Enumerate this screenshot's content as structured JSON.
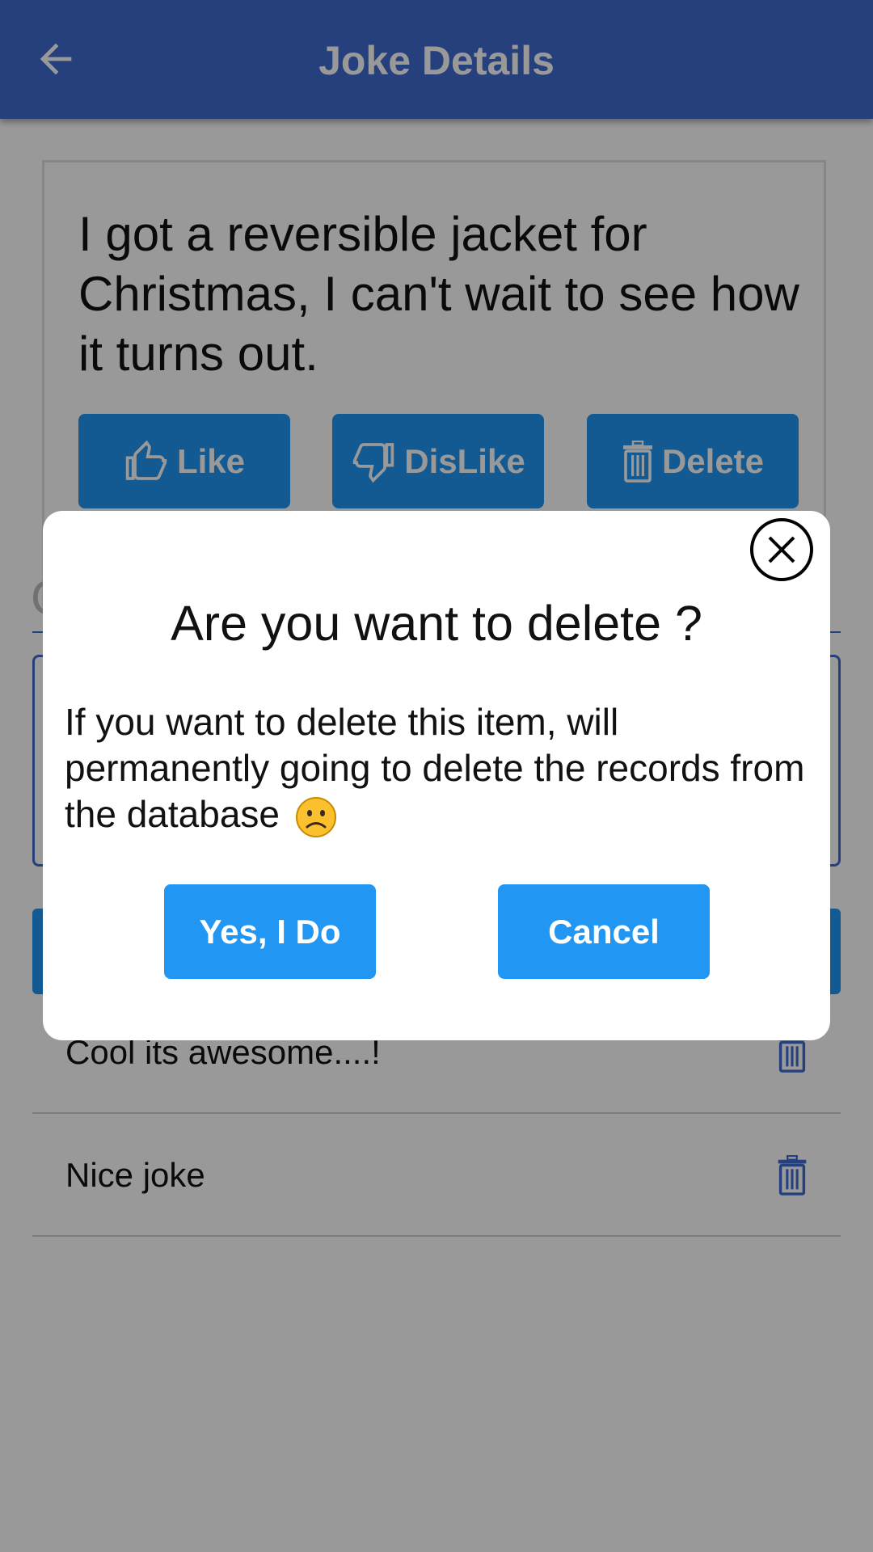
{
  "appbar": {
    "title": "Joke Details",
    "back_icon": "arrow-left-icon"
  },
  "joke": {
    "text": "I got a reversible jacket for Christmas, I can't wait to see how it turns out.",
    "actions": {
      "like_label": "Like",
      "dislike_label": "DisLike",
      "delete_label": "Delete"
    }
  },
  "comments_heading_fragment": "C",
  "comments": [
    {
      "text": "Cool its awesome....!",
      "icon": "trash-icon"
    },
    {
      "text": "Nice joke",
      "icon": "trash-icon"
    }
  ],
  "dialog": {
    "title": "Are you want to delete ?",
    "message": "If you want to delete this item, will permanently going to delete the records from the database",
    "emoji": "frowning-face-emoji",
    "confirm_label": "Yes, I Do",
    "cancel_label": "Cancel",
    "close_icon": "close-circle-icon"
  },
  "colors": {
    "appbar": "#3f6bd1",
    "button": "#2196f3",
    "overlay": "rgba(0,0,0,0.4)"
  }
}
